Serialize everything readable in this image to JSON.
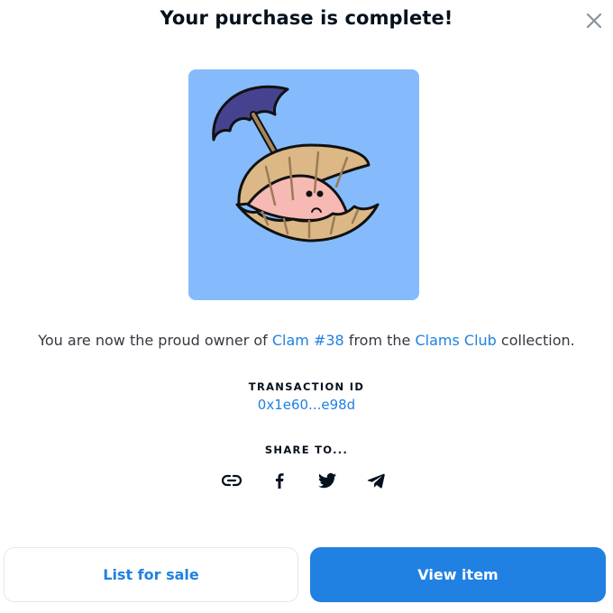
{
  "modal": {
    "title": "Your purchase is complete!",
    "close_icon": "close-icon"
  },
  "artwork": {
    "icon": "clam-nft-image",
    "background": "#85bbfc"
  },
  "ownership": {
    "prefix": "You are now the proud owner of ",
    "item_name": "Clam #38",
    "middle": " from the ",
    "collection_name": "Clams Club",
    "suffix": " collection."
  },
  "transaction": {
    "label": "TRANSACTION ID",
    "id": "0x1e60...e98d"
  },
  "share": {
    "label": "SHARE TO...",
    "targets": [
      "link-icon",
      "facebook-icon",
      "twitter-icon",
      "telegram-icon"
    ]
  },
  "actions": {
    "list_label": "List for sale",
    "view_label": "View item"
  },
  "colors": {
    "accent": "#2081e2",
    "text": "#04111d",
    "secondary_text": "#353840"
  }
}
